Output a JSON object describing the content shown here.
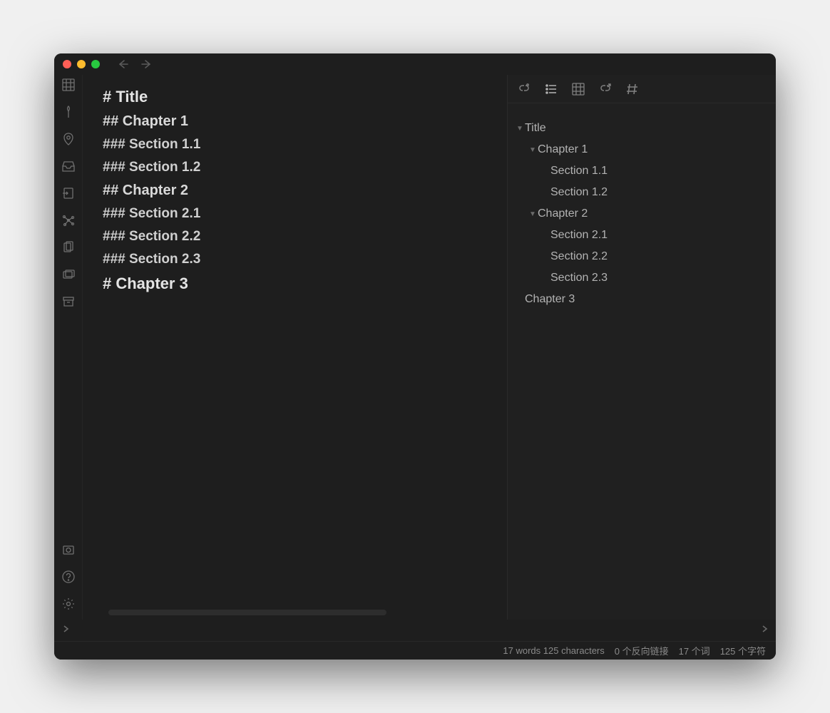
{
  "editor": {
    "lines": [
      {
        "text": "# Title",
        "cls": "h1"
      },
      {
        "text": "## Chapter 1",
        "cls": "h2"
      },
      {
        "text": "### Section 1.1",
        "cls": "h3"
      },
      {
        "text": "### Section 1.2",
        "cls": "h3"
      },
      {
        "text": "## Chapter 2",
        "cls": "h2"
      },
      {
        "text": "### Section 2.1",
        "cls": "h3"
      },
      {
        "text": "### Section 2.2",
        "cls": "h3"
      },
      {
        "text": "### Section 2.3",
        "cls": "h3"
      },
      {
        "text": "# Chapter 3",
        "cls": "h1"
      }
    ]
  },
  "outline": {
    "items": [
      {
        "label": "Title",
        "level": 0,
        "caret": true
      },
      {
        "label": "Chapter 1",
        "level": 1,
        "caret": true
      },
      {
        "label": "Section 1.1",
        "level": 2,
        "caret": false
      },
      {
        "label": "Section 1.2",
        "level": 2,
        "caret": false
      },
      {
        "label": "Chapter 2",
        "level": 1,
        "caret": true
      },
      {
        "label": "Section 2.1",
        "level": 2,
        "caret": false
      },
      {
        "label": "Section 2.2",
        "level": 2,
        "caret": false
      },
      {
        "label": "Section 2.3",
        "level": 2,
        "caret": false
      },
      {
        "label": "Chapter 3",
        "level": 0,
        "caret": false
      }
    ]
  },
  "status": {
    "words_chars": "17 words 125 characters",
    "backlinks": "0 个反向链接",
    "words_cn": "17 个词",
    "chars_cn": "125 个字符"
  }
}
